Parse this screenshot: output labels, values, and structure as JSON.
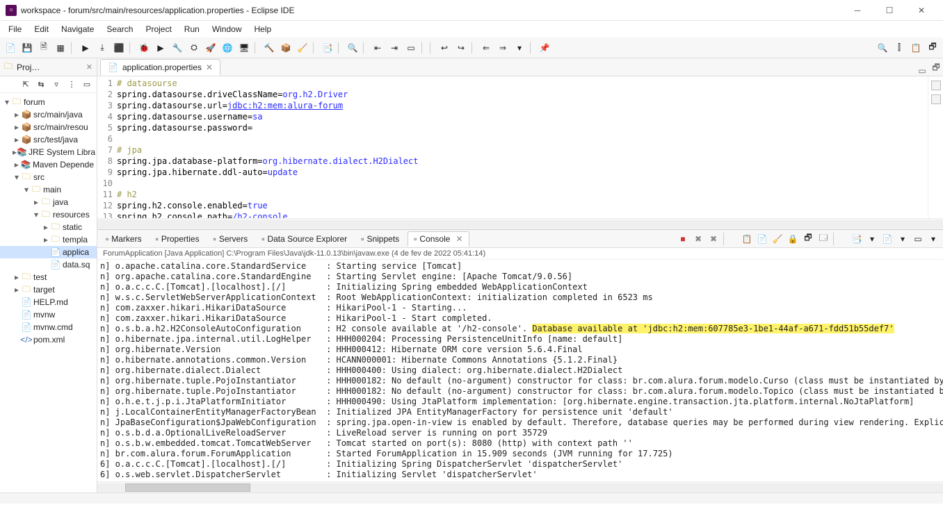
{
  "window": {
    "title": "workspace - forum/src/main/resources/application.properties - Eclipse IDE"
  },
  "menu": {
    "items": [
      "File",
      "Edit",
      "Navigate",
      "Search",
      "Project",
      "Run",
      "Window",
      "Help"
    ]
  },
  "sidebar": {
    "view_label": "Proj…",
    "nodes": [
      {
        "depth": 0,
        "tw": "▾",
        "icon": "folder",
        "label": "forum"
      },
      {
        "depth": 1,
        "tw": "▸",
        "icon": "pkg",
        "label": "src/main/java"
      },
      {
        "depth": 1,
        "tw": "▸",
        "icon": "pkg",
        "label": "src/main/resou"
      },
      {
        "depth": 1,
        "tw": "▸",
        "icon": "pkg",
        "label": "src/test/java"
      },
      {
        "depth": 1,
        "tw": "▸",
        "icon": "lib",
        "label": "JRE System Libra"
      },
      {
        "depth": 1,
        "tw": "▸",
        "icon": "lib",
        "label": "Maven Depende"
      },
      {
        "depth": 1,
        "tw": "▾",
        "icon": "folder",
        "label": "src"
      },
      {
        "depth": 2,
        "tw": "▾",
        "icon": "folder",
        "label": "main"
      },
      {
        "depth": 3,
        "tw": "▸",
        "icon": "folder",
        "label": "java"
      },
      {
        "depth": 3,
        "tw": "▾",
        "icon": "folder",
        "label": "resources"
      },
      {
        "depth": 4,
        "tw": "▸",
        "icon": "folder",
        "label": "static"
      },
      {
        "depth": 4,
        "tw": "▸",
        "icon": "folder",
        "label": "templa"
      },
      {
        "depth": 4,
        "tw": " ",
        "icon": "file",
        "label": "applica",
        "sel": true
      },
      {
        "depth": 4,
        "tw": " ",
        "icon": "file",
        "label": "data.sq"
      },
      {
        "depth": 1,
        "tw": "▸",
        "icon": "folder",
        "label": "test"
      },
      {
        "depth": 1,
        "tw": "▸",
        "icon": "folder",
        "label": "target"
      },
      {
        "depth": 1,
        "tw": " ",
        "icon": "file",
        "label": "HELP.md"
      },
      {
        "depth": 1,
        "tw": " ",
        "icon": "file",
        "label": "mvnw"
      },
      {
        "depth": 1,
        "tw": " ",
        "icon": "file",
        "label": "mvnw.cmd"
      },
      {
        "depth": 1,
        "tw": " ",
        "icon": "xml",
        "label": "pom.xml"
      }
    ]
  },
  "editor": {
    "tab_label": "application.properties",
    "lines": [
      {
        "n": 1,
        "t": "comment",
        "text": "# datasourse"
      },
      {
        "n": 2,
        "t": "kv",
        "k": "spring.datasourse.driveClassName=",
        "v": "org.h2.Driver"
      },
      {
        "n": 3,
        "t": "kv",
        "k": "spring.datasourse.url=",
        "v": "jdbc:h2:mem:alura-forum",
        "url": true
      },
      {
        "n": 4,
        "t": "kv",
        "k": "spring.datasourse.username=",
        "v": "sa"
      },
      {
        "n": 5,
        "t": "kv",
        "k": "spring.datasourse.password=",
        "v": ""
      },
      {
        "n": 6,
        "t": "blank",
        "text": ""
      },
      {
        "n": 7,
        "t": "comment",
        "text": "# jpa"
      },
      {
        "n": 8,
        "t": "kv",
        "k": "spring.jpa.database-platform=",
        "v": "org.hibernate.dialect.H2Dialect"
      },
      {
        "n": 9,
        "t": "kv",
        "k": "spring.jpa.hibernate.ddl-auto=",
        "v": "update"
      },
      {
        "n": 10,
        "t": "blank",
        "text": ""
      },
      {
        "n": 11,
        "t": "comment",
        "text": "# h2",
        "hl": true
      },
      {
        "n": 12,
        "t": "kv",
        "k": "spring.h2.console.enabled=",
        "v": "true"
      },
      {
        "n": 13,
        "t": "kv",
        "k": "spring.h2.console.path=",
        "v": "/h2-console"
      },
      {
        "n": 14,
        "t": "blank",
        "text": ""
      }
    ]
  },
  "bottom": {
    "tabs": [
      {
        "label": "Markers"
      },
      {
        "label": "Properties"
      },
      {
        "label": "Servers"
      },
      {
        "label": "Data Source Explorer"
      },
      {
        "label": "Snippets"
      },
      {
        "label": "Console",
        "active": true
      }
    ],
    "launch": "ForumApplication [Java Application] C:\\Program Files\\Java\\jdk-11.0.13\\bin\\javaw.exe (4 de fev de 2022 05:41:14)",
    "lines": [
      {
        "p": "n] o.apache.catalina.core.StandardService    : ",
        "m": "Starting service [Tomcat]"
      },
      {
        "p": "n] org.apache.catalina.core.StandardEngine   : ",
        "m": "Starting Servlet engine: [Apache Tomcat/9.0.56]"
      },
      {
        "p": "n] o.a.c.c.C.[Tomcat].[localhost].[/]        : ",
        "m": "Initializing Spring embedded WebApplicationContext"
      },
      {
        "p": "n] w.s.c.ServletWebServerApplicationContext  : ",
        "m": "Root WebApplicationContext: initialization completed in 6523 ms"
      },
      {
        "p": "n] com.zaxxer.hikari.HikariDataSource        : ",
        "m": "HikariPool-1 - Starting..."
      },
      {
        "p": "n] com.zaxxer.hikari.HikariDataSource        : ",
        "m": "HikariPool-1 - Start completed."
      },
      {
        "p": "n] o.s.b.a.h2.H2ConsoleAutoConfiguration     : ",
        "m": "H2 console available at '/h2-console'. ",
        "hl": "Database available at 'jdbc:h2:mem:607785e3-1be1-44af-a671-fdd51b55def7'"
      },
      {
        "p": "n] o.hibernate.jpa.internal.util.LogHelper   : ",
        "m": "HHH000204: Processing PersistenceUnitInfo [name: default]"
      },
      {
        "p": "n] org.hibernate.Version                     : ",
        "m": "HHH000412: Hibernate ORM core version 5.6.4.Final"
      },
      {
        "p": "n] o.hibernate.annotations.common.Version    : ",
        "m": "HCANN000001: Hibernate Commons Annotations {5.1.2.Final}"
      },
      {
        "p": "n] org.hibernate.dialect.Dialect             : ",
        "m": "HHH000400: Using dialect: org.hibernate.dialect.H2Dialect"
      },
      {
        "p": "n] org.hibernate.tuple.PojoInstantiator      : ",
        "m": "HHH000182: No default (no-argument) constructor for class: br.com.alura.forum.modelo.Curso (class must be instantiated by"
      },
      {
        "p": "n] org.hibernate.tuple.PojoInstantiator      : ",
        "m": "HHH000182: No default (no-argument) constructor for class: br.com.alura.forum.modelo.Topico (class must be instantiated b"
      },
      {
        "p": "n] o.h.e.t.j.p.i.JtaPlatformInitiator        : ",
        "m": "HHH000490: Using JtaPlatform implementation: [org.hibernate.engine.transaction.jta.platform.internal.NoJtaPlatform]"
      },
      {
        "p": "n] j.LocalContainerEntityManagerFactoryBean  : ",
        "m": "Initialized JPA EntityManagerFactory for persistence unit 'default'"
      },
      {
        "p": "n] JpaBaseConfiguration$JpaWebConfiguration  : ",
        "m": "spring.jpa.open-in-view is enabled by default. Therefore, database queries may be performed during view rendering. Explic"
      },
      {
        "p": "n] o.s.b.d.a.OptionalLiveReloadServer        : ",
        "m": "LiveReload server is running on port 35729"
      },
      {
        "p": "n] o.s.b.w.embedded.tomcat.TomcatWebServer   : ",
        "m": "Tomcat started on port(s): 8080 (http) with context path ''"
      },
      {
        "p": "n] br.com.alura.forum.ForumApplication       : ",
        "m": "Started ForumApplication in 15.909 seconds (JVM running for 17.725)"
      },
      {
        "p": "6] o.a.c.c.C.[Tomcat].[localhost].[/]        : ",
        "m": "Initializing Spring DispatcherServlet 'dispatcherServlet'"
      },
      {
        "p": "6] o.s.web.servlet.DispatcherServlet         : ",
        "m": "Initializing Servlet 'dispatcherServlet'"
      }
    ]
  },
  "toolbar_icons": [
    "📄",
    "💾",
    "🗎",
    "▦",
    "│",
    "▶",
    "⤓",
    "⬛",
    "│",
    "🐞",
    "▶",
    "🔧",
    "⛭",
    "🚀",
    "🌐",
    "🖥",
    "│",
    "🔨",
    "📦",
    "🧹",
    "│",
    "📑",
    "│",
    "🔍",
    "│",
    "⇤",
    "⇥",
    "▭",
    "│",
    "│",
    "↩",
    "↪",
    "│",
    "⇐",
    "⇒",
    "▾",
    "│",
    "📌"
  ],
  "toolbar_right": [
    "🔍",
    "⫿",
    "📋",
    "🗗"
  ],
  "console_tool_icons": [
    "■",
    "✖",
    "✖",
    "│",
    "📋",
    "📄",
    "🧹",
    "🔒",
    "🗗",
    "🗔",
    "│",
    "📑",
    "▾",
    "📄",
    "▾",
    "▭",
    "▾"
  ]
}
